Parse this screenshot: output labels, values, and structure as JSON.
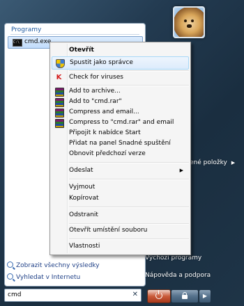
{
  "programs": {
    "header": "Programy",
    "items": [
      {
        "label": "cmd.exe",
        "icon": "cmd-icon"
      }
    ]
  },
  "bottom_links": [
    {
      "label": "Zobrazit všechny výsledky",
      "icon": "search-icon"
    },
    {
      "label": "Vyhledat v Internetu",
      "icon": "search-icon"
    }
  ],
  "search": {
    "value": "cmd",
    "clear_glyph": "✕"
  },
  "right_panel": {
    "items": [
      {
        "label": "ené položky",
        "has_submenu": true
      },
      {
        "label": "Výchozí programy"
      },
      {
        "label": "Nápověda a podpora"
      }
    ]
  },
  "context_menu": {
    "items": [
      {
        "label": "Otevřít",
        "bold": true
      },
      {
        "label": "Spustit jako správce",
        "icon": "uac-shield-icon",
        "highlighted": true
      },
      {
        "separator": true
      },
      {
        "label": "Check for viruses",
        "icon": "kaspersky-icon"
      },
      {
        "separator": true
      },
      {
        "label": "Add to archive...",
        "icon": "winrar-icon"
      },
      {
        "label": "Add to \"cmd.rar\"",
        "icon": "winrar-icon"
      },
      {
        "label": "Compress and email...",
        "icon": "winrar-icon"
      },
      {
        "label": "Compress to \"cmd.rar\" and email",
        "icon": "winrar-icon"
      },
      {
        "label": "Připojit k nabídce Start"
      },
      {
        "label": "Přidat na panel Snadné spuštění"
      },
      {
        "label": "Obnovit předchozí verze"
      },
      {
        "separator": true
      },
      {
        "label": "Odeslat",
        "has_submenu": true
      },
      {
        "separator": true
      },
      {
        "label": "Vyjmout"
      },
      {
        "label": "Kopírovat"
      },
      {
        "separator": true
      },
      {
        "label": "Odstranit"
      },
      {
        "separator": true
      },
      {
        "label": "Otevřít umístění souboru"
      },
      {
        "separator": true
      },
      {
        "label": "Vlastnosti"
      }
    ]
  },
  "colors": {
    "highlight_border": "#a8d8f7",
    "programs_header": "#1e5aa0",
    "power_button": "#c95b3a"
  }
}
